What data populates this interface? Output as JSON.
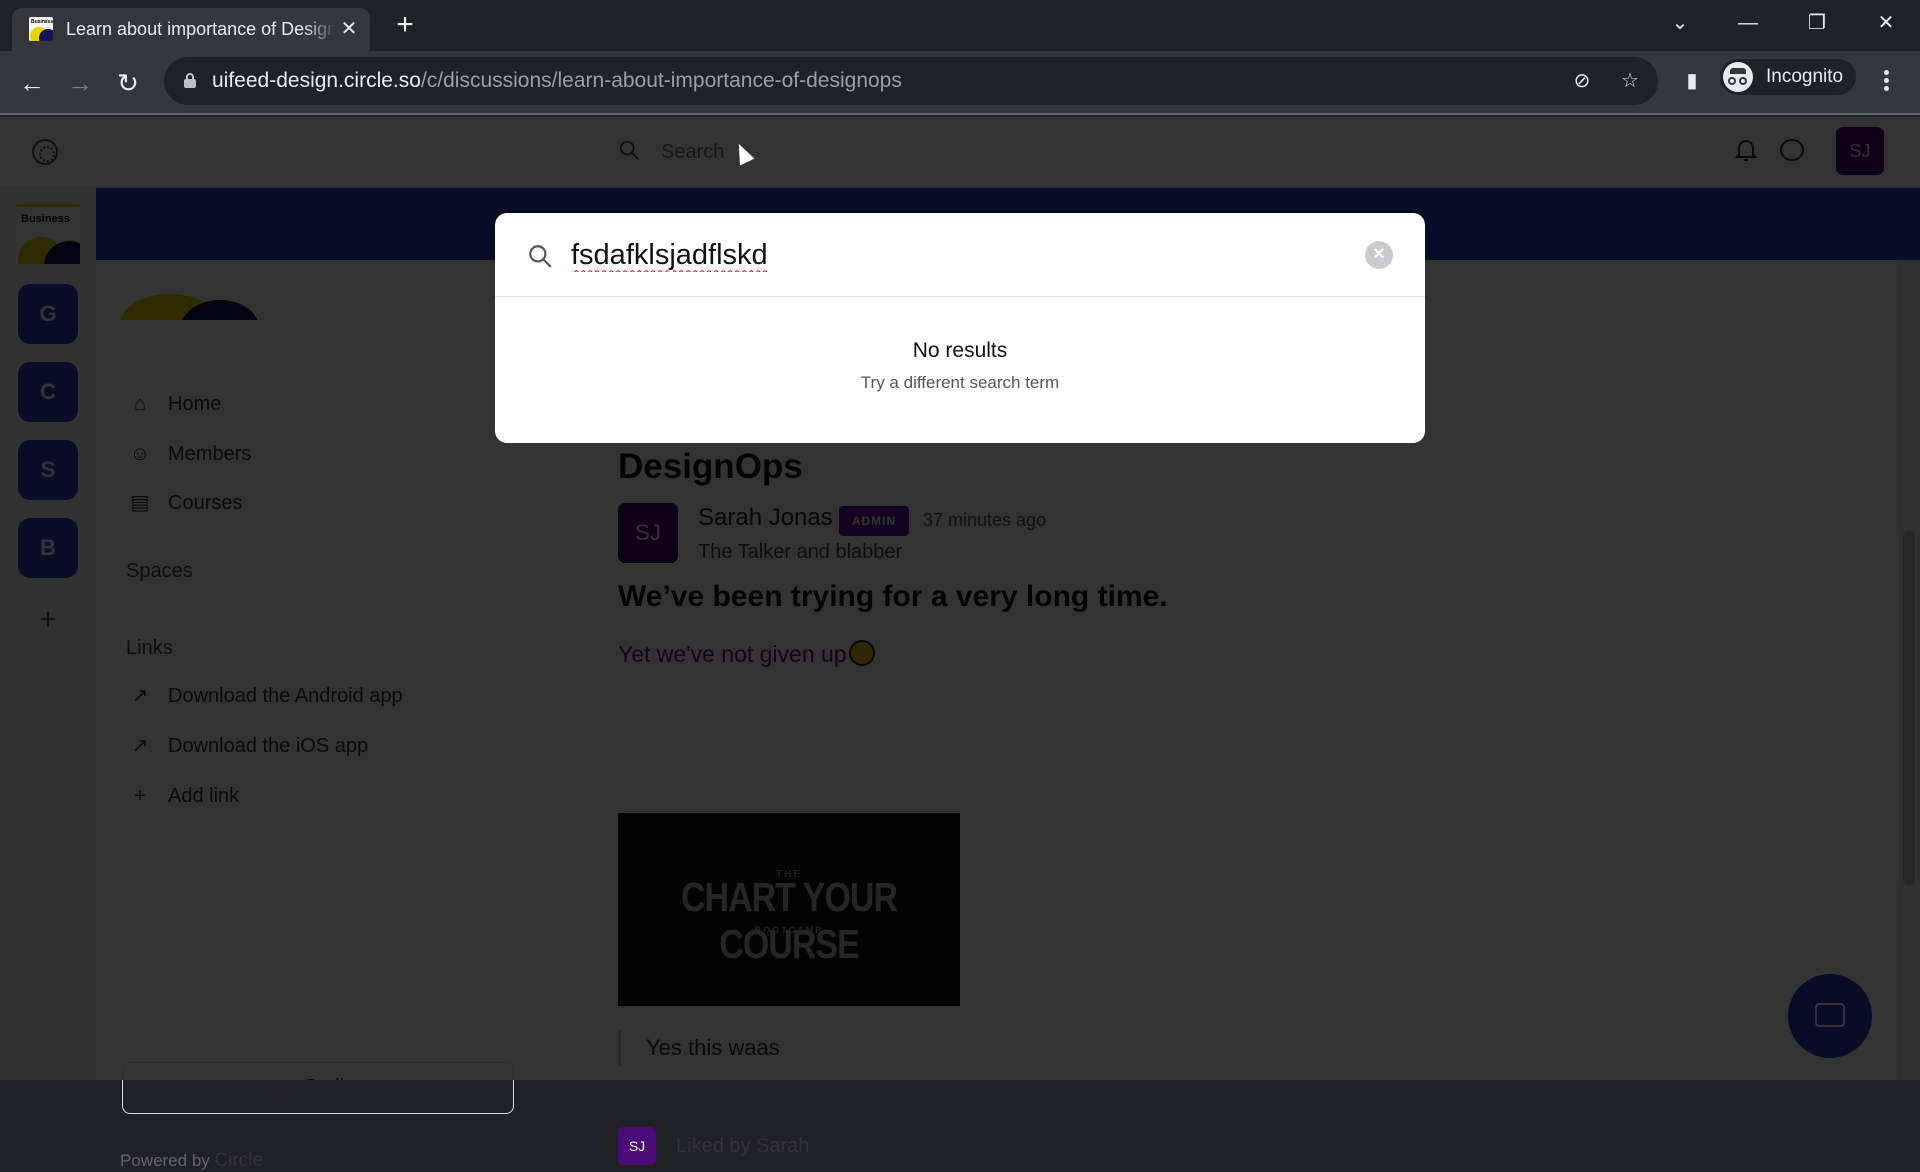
{
  "browser": {
    "tab_title": "Learn about importance of DesignOps",
    "tab_close": "✕",
    "new_tab": "+",
    "url_host": "uifeed-design.circle.so",
    "url_path": "/c/discussions/learn-about-importance-of-designops",
    "profile_label": "Incognito",
    "window_controls": {
      "list": "⌄",
      "minimize": "—",
      "restore": "❐",
      "close": "✕"
    },
    "nav": {
      "back": "←",
      "forward": "→",
      "reload": "↻"
    },
    "omnibox_icons": {
      "eye_off": "⊘",
      "star": "☆",
      "sidebar": "▮"
    }
  },
  "header": {
    "search_placeholder": "Search",
    "avatar_initials": "SJ"
  },
  "rail": {
    "community_label": "Business",
    "communities": [
      "G",
      "C",
      "S",
      "B"
    ],
    "add": "+"
  },
  "sidebar": {
    "nav": [
      {
        "label": "Home",
        "icon": "⌂"
      },
      {
        "label": "Members",
        "icon": "☺"
      },
      {
        "label": "Courses",
        "icon": "▤"
      }
    ],
    "spaces_heading": "Spaces",
    "links_heading": "Links",
    "links": [
      {
        "label": "Download the Android app",
        "icon": "↗"
      },
      {
        "label": "Download the iOS app",
        "icon": "↗"
      },
      {
        "label": "Add link",
        "icon": "+"
      }
    ],
    "go_live_label": "Go live",
    "powered_by": "Powered by",
    "powered_brand": "Circle"
  },
  "post": {
    "space_title": "DesignOps",
    "author_initials": "SJ",
    "author_name": "Sarah Jonas",
    "author_badge": "ADMIN",
    "timestamp": "37 minutes ago",
    "author_headline": "The Talker and blabber",
    "heading": "We’ve been trying for a very long time.",
    "subheading": "Yet we've not given up",
    "image": {
      "line1": "THE",
      "line2": "CHART YOUR COURSE",
      "line3": "BOOTCAMP"
    },
    "quote": "Yes this waas",
    "liked_initials": "SJ",
    "liked_by": "Liked by Sarah"
  },
  "search_modal": {
    "query": "fsdafklsjadflskd",
    "clear": "✕",
    "empty_title": "No results",
    "empty_subtitle": "Try a different search term"
  },
  "colors": {
    "brand": "#2d3cbf",
    "avatar": "#4a0a78",
    "badge": "#5b13a6",
    "accent_yellow": "#e4d400"
  }
}
